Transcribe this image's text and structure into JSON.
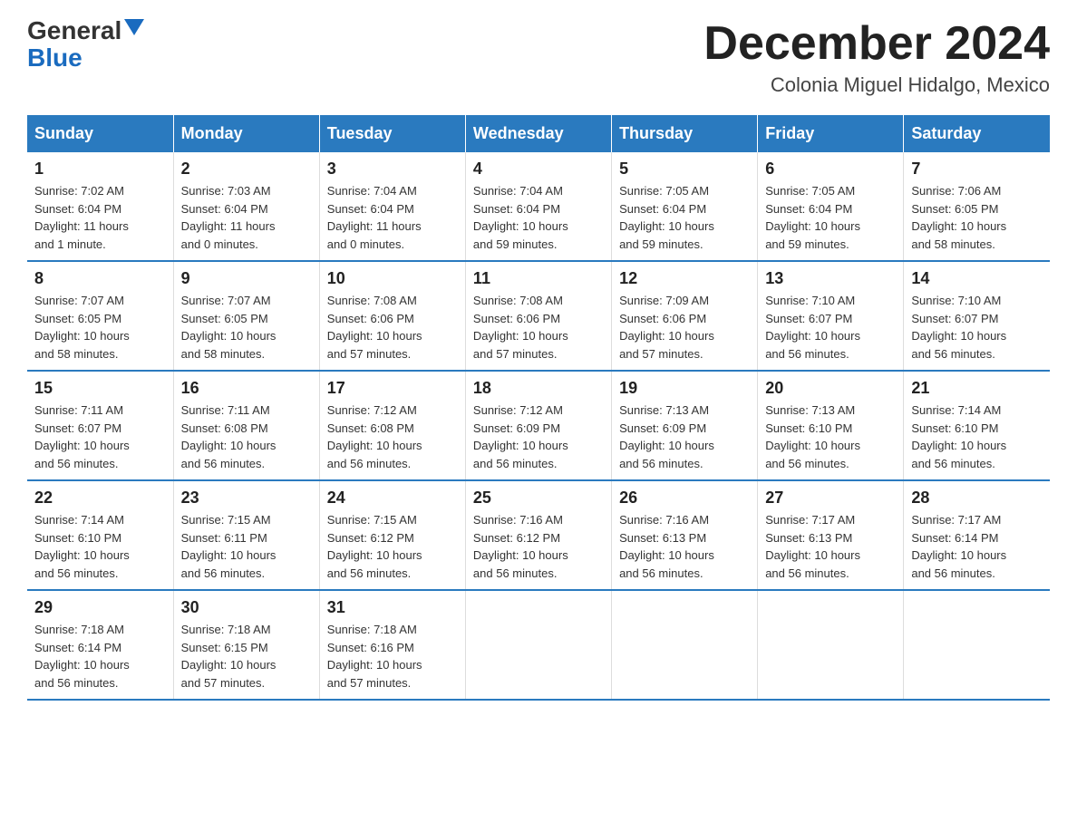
{
  "header": {
    "logo_line1": "General",
    "logo_line2": "Blue",
    "month_title": "December 2024",
    "location": "Colonia Miguel Hidalgo, Mexico"
  },
  "days_of_week": [
    "Sunday",
    "Monday",
    "Tuesday",
    "Wednesday",
    "Thursday",
    "Friday",
    "Saturday"
  ],
  "weeks": [
    [
      {
        "day": "1",
        "sunrise": "7:02 AM",
        "sunset": "6:04 PM",
        "daylight": "11 hours and 1 minute."
      },
      {
        "day": "2",
        "sunrise": "7:03 AM",
        "sunset": "6:04 PM",
        "daylight": "11 hours and 0 minutes."
      },
      {
        "day": "3",
        "sunrise": "7:04 AM",
        "sunset": "6:04 PM",
        "daylight": "11 hours and 0 minutes."
      },
      {
        "day": "4",
        "sunrise": "7:04 AM",
        "sunset": "6:04 PM",
        "daylight": "10 hours and 59 minutes."
      },
      {
        "day": "5",
        "sunrise": "7:05 AM",
        "sunset": "6:04 PM",
        "daylight": "10 hours and 59 minutes."
      },
      {
        "day": "6",
        "sunrise": "7:05 AM",
        "sunset": "6:04 PM",
        "daylight": "10 hours and 59 minutes."
      },
      {
        "day": "7",
        "sunrise": "7:06 AM",
        "sunset": "6:05 PM",
        "daylight": "10 hours and 58 minutes."
      }
    ],
    [
      {
        "day": "8",
        "sunrise": "7:07 AM",
        "sunset": "6:05 PM",
        "daylight": "10 hours and 58 minutes."
      },
      {
        "day": "9",
        "sunrise": "7:07 AM",
        "sunset": "6:05 PM",
        "daylight": "10 hours and 58 minutes."
      },
      {
        "day": "10",
        "sunrise": "7:08 AM",
        "sunset": "6:06 PM",
        "daylight": "10 hours and 57 minutes."
      },
      {
        "day": "11",
        "sunrise": "7:08 AM",
        "sunset": "6:06 PM",
        "daylight": "10 hours and 57 minutes."
      },
      {
        "day": "12",
        "sunrise": "7:09 AM",
        "sunset": "6:06 PM",
        "daylight": "10 hours and 57 minutes."
      },
      {
        "day": "13",
        "sunrise": "7:10 AM",
        "sunset": "6:07 PM",
        "daylight": "10 hours and 56 minutes."
      },
      {
        "day": "14",
        "sunrise": "7:10 AM",
        "sunset": "6:07 PM",
        "daylight": "10 hours and 56 minutes."
      }
    ],
    [
      {
        "day": "15",
        "sunrise": "7:11 AM",
        "sunset": "6:07 PM",
        "daylight": "10 hours and 56 minutes."
      },
      {
        "day": "16",
        "sunrise": "7:11 AM",
        "sunset": "6:08 PM",
        "daylight": "10 hours and 56 minutes."
      },
      {
        "day": "17",
        "sunrise": "7:12 AM",
        "sunset": "6:08 PM",
        "daylight": "10 hours and 56 minutes."
      },
      {
        "day": "18",
        "sunrise": "7:12 AM",
        "sunset": "6:09 PM",
        "daylight": "10 hours and 56 minutes."
      },
      {
        "day": "19",
        "sunrise": "7:13 AM",
        "sunset": "6:09 PM",
        "daylight": "10 hours and 56 minutes."
      },
      {
        "day": "20",
        "sunrise": "7:13 AM",
        "sunset": "6:10 PM",
        "daylight": "10 hours and 56 minutes."
      },
      {
        "day": "21",
        "sunrise": "7:14 AM",
        "sunset": "6:10 PM",
        "daylight": "10 hours and 56 minutes."
      }
    ],
    [
      {
        "day": "22",
        "sunrise": "7:14 AM",
        "sunset": "6:10 PM",
        "daylight": "10 hours and 56 minutes."
      },
      {
        "day": "23",
        "sunrise": "7:15 AM",
        "sunset": "6:11 PM",
        "daylight": "10 hours and 56 minutes."
      },
      {
        "day": "24",
        "sunrise": "7:15 AM",
        "sunset": "6:12 PM",
        "daylight": "10 hours and 56 minutes."
      },
      {
        "day": "25",
        "sunrise": "7:16 AM",
        "sunset": "6:12 PM",
        "daylight": "10 hours and 56 minutes."
      },
      {
        "day": "26",
        "sunrise": "7:16 AM",
        "sunset": "6:13 PM",
        "daylight": "10 hours and 56 minutes."
      },
      {
        "day": "27",
        "sunrise": "7:17 AM",
        "sunset": "6:13 PM",
        "daylight": "10 hours and 56 minutes."
      },
      {
        "day": "28",
        "sunrise": "7:17 AM",
        "sunset": "6:14 PM",
        "daylight": "10 hours and 56 minutes."
      }
    ],
    [
      {
        "day": "29",
        "sunrise": "7:18 AM",
        "sunset": "6:14 PM",
        "daylight": "10 hours and 56 minutes."
      },
      {
        "day": "30",
        "sunrise": "7:18 AM",
        "sunset": "6:15 PM",
        "daylight": "10 hours and 57 minutes."
      },
      {
        "day": "31",
        "sunrise": "7:18 AM",
        "sunset": "6:16 PM",
        "daylight": "10 hours and 57 minutes."
      },
      null,
      null,
      null,
      null
    ]
  ]
}
